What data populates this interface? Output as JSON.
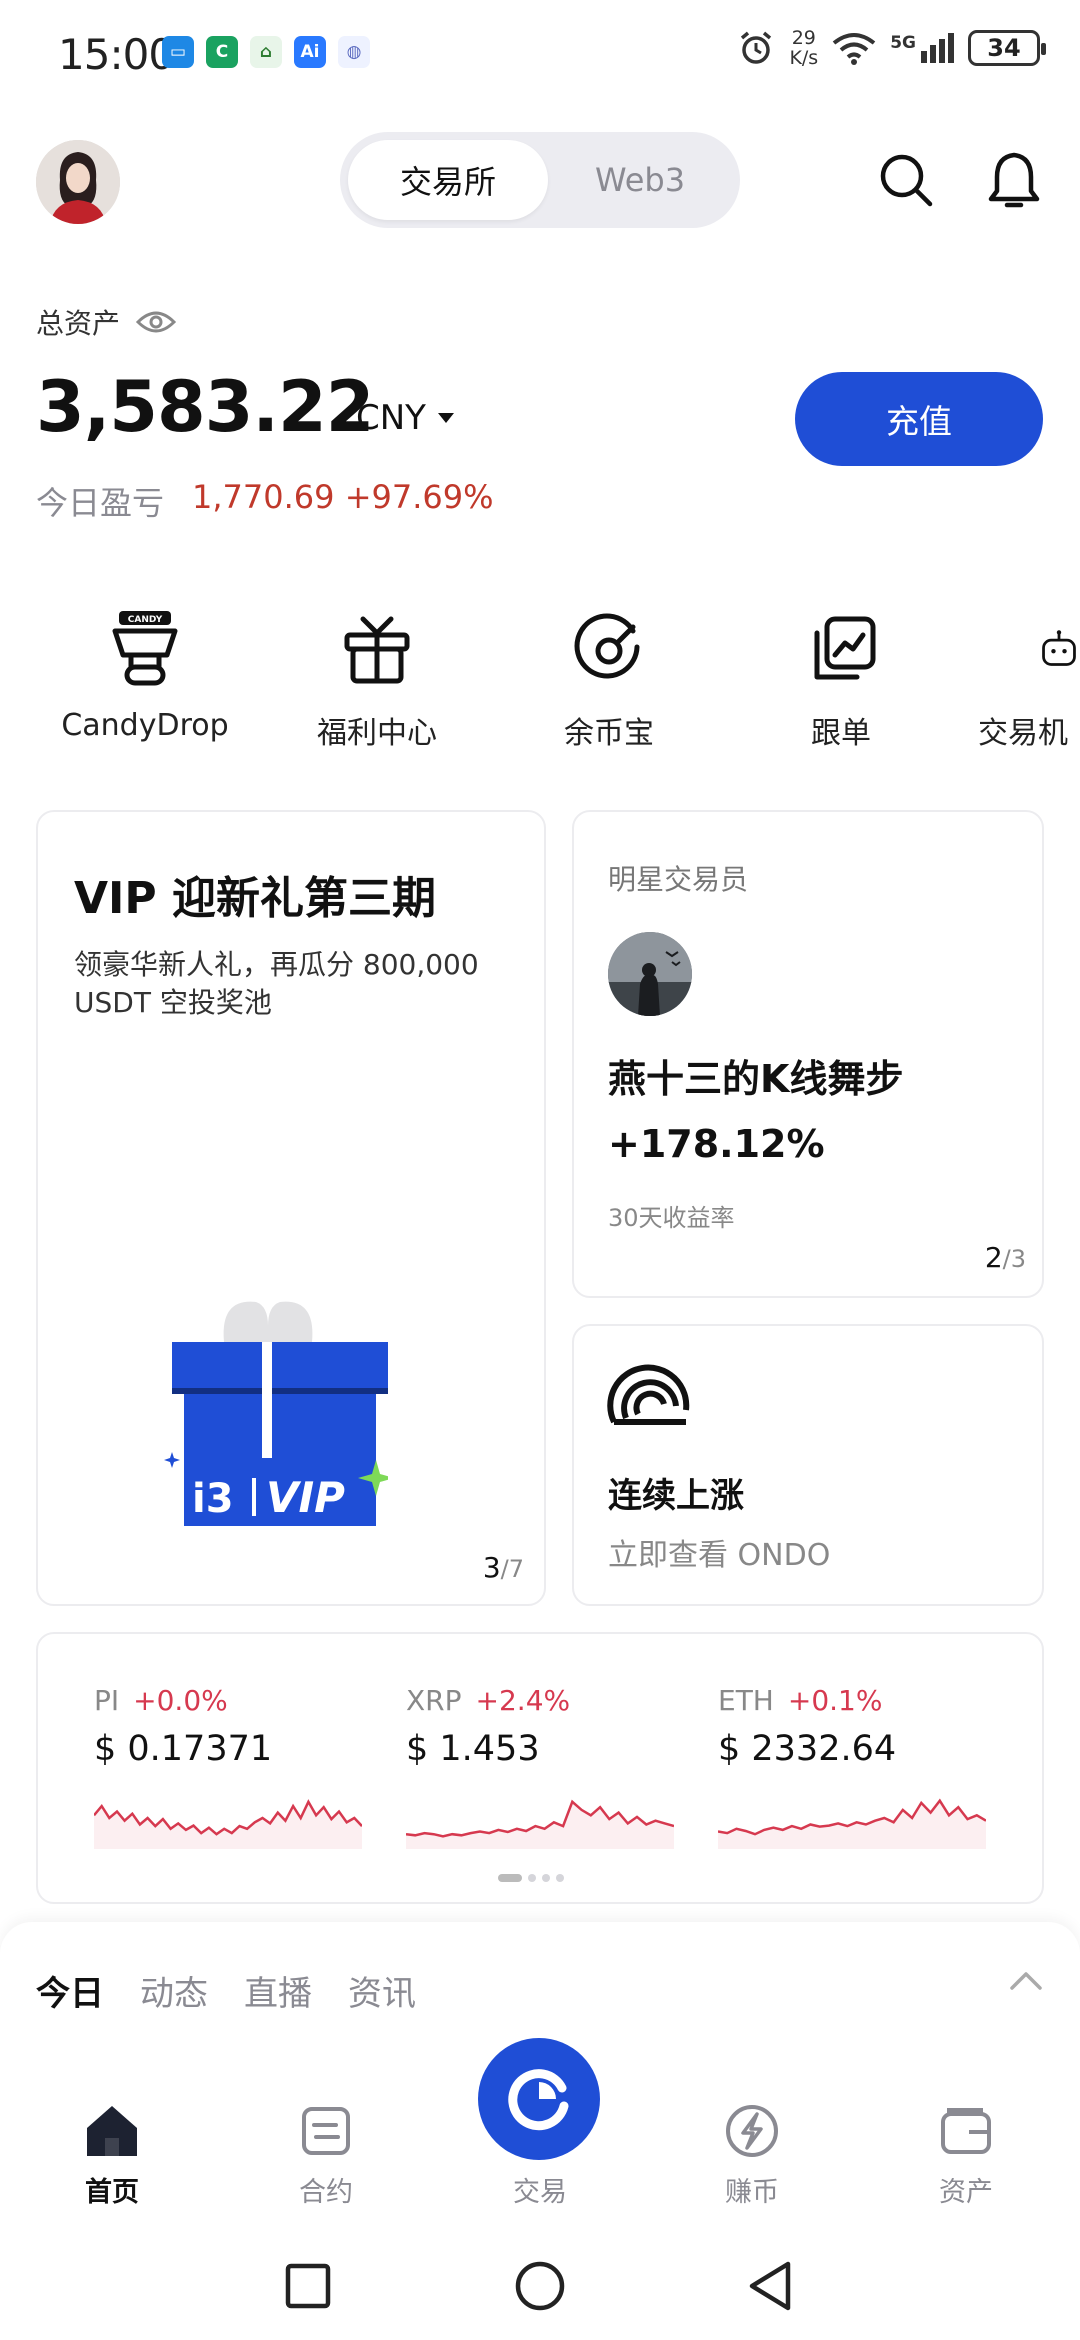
{
  "status_bar": {
    "time": "15:00",
    "net_speed_value": "29",
    "net_speed_unit": "K/s",
    "network": "5G",
    "battery": "34"
  },
  "header": {
    "tabs": [
      "交易所",
      "Web3"
    ],
    "active_tab": "交易所"
  },
  "assets": {
    "label": "总资产",
    "value": "3,583.22",
    "currency": "CNY",
    "pnl_label": "今日盈亏",
    "pnl_value": "1,770.69 +97.69%",
    "deposit_label": "充值"
  },
  "shortcuts": [
    {
      "label": "CandyDrop",
      "icon": "candy-drop-icon"
    },
    {
      "label": "福利中心",
      "icon": "gift-icon"
    },
    {
      "label": "余币宝",
      "icon": "savings-icon"
    },
    {
      "label": "跟单",
      "icon": "copy-trade-icon"
    },
    {
      "label": "交易机",
      "icon": "bot-icon"
    }
  ],
  "vip_card": {
    "title": "VIP 迎新礼第三期",
    "desc": "领豪华新人礼，再瓜分 800,000 USDT 空投奖池",
    "badge_brand": "i3",
    "badge_vip": "VIP",
    "page": "3",
    "total": "/7"
  },
  "trader_card": {
    "label": "明星交易员",
    "name": "燕十三的K线舞步",
    "return": "+178.12%",
    "sub": "30天收益率",
    "page": "2",
    "total": "/3"
  },
  "ondo_card": {
    "title": "连续上涨",
    "subtitle": "立即查看 ONDO"
  },
  "markets": [
    {
      "symbol": "PI",
      "change": "+0.0%",
      "price": "$ 0.17371",
      "spark": [
        0.55,
        0.72,
        0.5,
        0.62,
        0.45,
        0.58,
        0.38,
        0.5,
        0.35,
        0.48,
        0.3,
        0.4,
        0.28,
        0.36,
        0.22,
        0.32,
        0.2,
        0.3,
        0.22,
        0.35,
        0.3,
        0.42,
        0.5,
        0.4,
        0.6,
        0.45,
        0.72,
        0.5,
        0.8,
        0.55,
        0.7,
        0.48,
        0.62,
        0.42,
        0.5,
        0.35
      ]
    },
    {
      "symbol": "XRP",
      "change": "+2.4%",
      "price": "$ 1.453",
      "spark": [
        0.2,
        0.18,
        0.22,
        0.2,
        0.16,
        0.2,
        0.18,
        0.22,
        0.25,
        0.22,
        0.28,
        0.24,
        0.3,
        0.26,
        0.35,
        0.3,
        0.42,
        0.35,
        0.8,
        0.65,
        0.55,
        0.7,
        0.48,
        0.6,
        0.4,
        0.52,
        0.38,
        0.45,
        0.4,
        0.35
      ]
    },
    {
      "symbol": "ETH",
      "change": "+0.1%",
      "price": "$ 2332.64",
      "spark": [
        0.25,
        0.22,
        0.3,
        0.26,
        0.2,
        0.28,
        0.32,
        0.28,
        0.35,
        0.3,
        0.38,
        0.34,
        0.36,
        0.4,
        0.35,
        0.42,
        0.38,
        0.45,
        0.5,
        0.42,
        0.65,
        0.5,
        0.78,
        0.6,
        0.82,
        0.55,
        0.7,
        0.48,
        0.55,
        0.45
      ]
    }
  ],
  "feed_tabs": [
    "今日",
    "动态",
    "直播",
    "资讯"
  ],
  "bottom_nav": [
    {
      "label": "首页"
    },
    {
      "label": "合约"
    },
    {
      "label": "交易"
    },
    {
      "label": "赚币"
    },
    {
      "label": "资产"
    }
  ],
  "colors": {
    "accent": "#1f4ed6",
    "up": "#d6394f",
    "pnl": "#c0392b"
  }
}
